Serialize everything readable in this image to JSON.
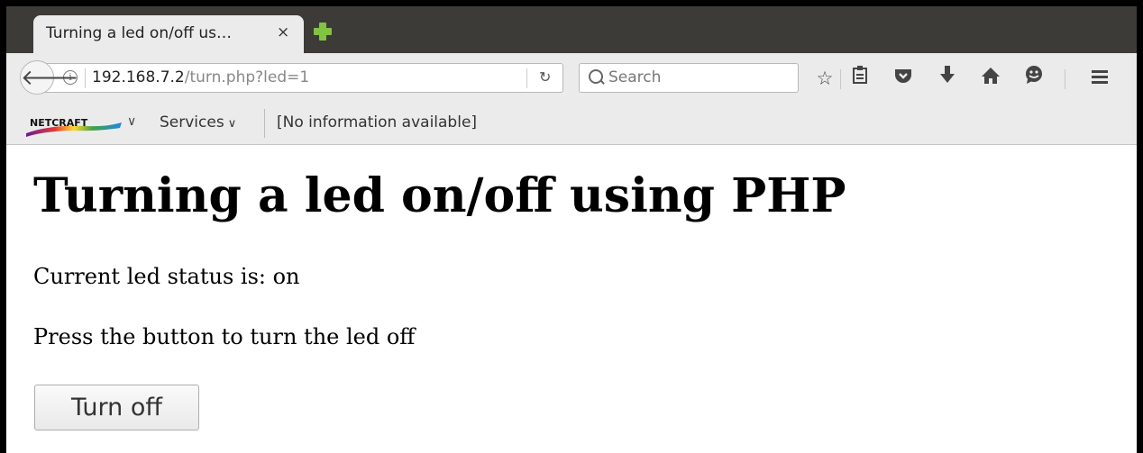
{
  "tab": {
    "title": "Turning a led on/off us…",
    "close": "×"
  },
  "navbar": {
    "url_host": "192.168.7.2",
    "url_path": "/turn.php?led=1",
    "search_placeholder": "Search"
  },
  "bookmarks_bar": {
    "logo_text": "NETCRAFT",
    "services_label": "Services",
    "site_info": "[No information available]"
  },
  "page": {
    "heading": "Turning a led on/off using PHP",
    "status": "Current led status is: on",
    "instruction": "Press the button to turn the led off",
    "button_label": "Turn off"
  },
  "colors": {
    "tabstrip_bg": "#3c3b37",
    "chrome_bg": "#ebebeb",
    "newtab_plus": "#82c341"
  },
  "icons": [
    "back-arrow-icon",
    "info-icon",
    "reload-icon",
    "search-icon",
    "bookmark-star-icon",
    "reading-list-icon",
    "pocket-icon",
    "download-icon",
    "home-icon",
    "hello-icon",
    "hamburger-menu-icon"
  ]
}
